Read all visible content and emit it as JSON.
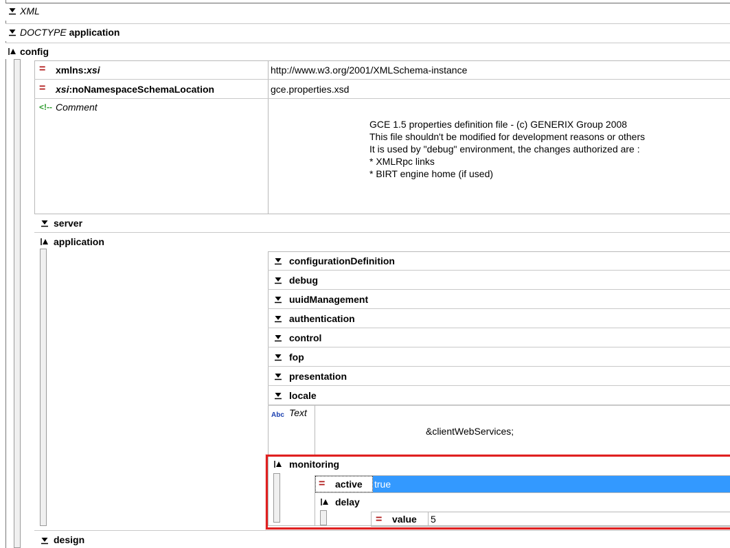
{
  "tree": {
    "xml": {
      "label": "XML"
    },
    "doctype": {
      "keyword": "DOCTYPE",
      "name": "application"
    },
    "config": {
      "label": "config",
      "attributes": [
        {
          "prefix": "xmlns:",
          "local": "xsi",
          "value": "http://www.w3.org/2001/XMLSchema-instance"
        },
        {
          "prefix": "xsi",
          "local": ":noNamespaceSchemaLocation",
          "value": "gce.properties.xsd"
        }
      ],
      "comment": {
        "label": "Comment",
        "lines": [
          "GCE 1.5 properties definition file - (c) GENERIX Group 2008",
          "This file shouldn't be modified for development reasons or others",
          "It is used by \"debug\" environment, the changes authorized are :",
          "* XMLRpc links",
          "* BIRT engine home (if used)"
        ]
      },
      "server": {
        "label": "server"
      },
      "application": {
        "label": "application",
        "children": [
          "configurationDefinition",
          "debug",
          "uuidManagement",
          "authentication",
          "control",
          "fop",
          "presentation",
          "locale"
        ],
        "text_node": {
          "label": "Text",
          "value": "&clientWebServices;"
        },
        "monitoring": {
          "label": "monitoring",
          "active": {
            "name": "active",
            "value": "true"
          },
          "delay": {
            "label": "delay",
            "value_attr": {
              "name": "value",
              "value": "5"
            }
          }
        }
      },
      "design": {
        "label": "design"
      }
    }
  },
  "colors": {
    "selection": "#3399ff",
    "highlight_border": "#e02020",
    "attribute_icon": "#b01818",
    "comment_icon": "#2a9a2a",
    "text_icon": "#1a3fb0"
  }
}
